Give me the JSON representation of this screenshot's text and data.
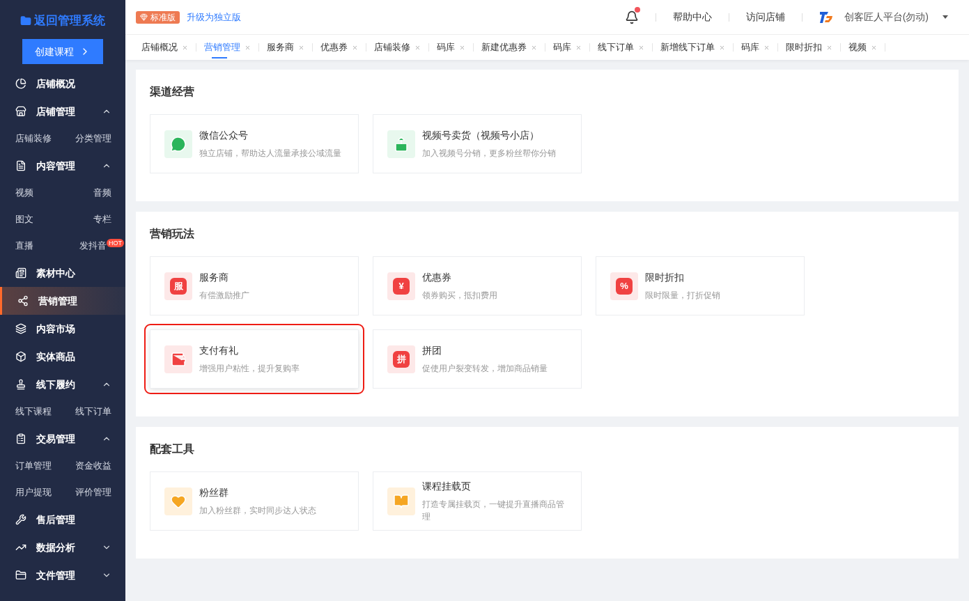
{
  "sidebar": {
    "title": "返回管理系统",
    "create_button": "创建课程",
    "items": [
      {
        "kind": "link",
        "label": "店铺概况",
        "selected": false
      },
      {
        "kind": "group",
        "label": "店铺管理",
        "selected": false,
        "expanded": true,
        "children": [
          {
            "label": "店铺装修"
          },
          {
            "label": "分类管理"
          }
        ]
      },
      {
        "kind": "group",
        "label": "内容管理",
        "selected": false,
        "expanded": true,
        "children": [
          {
            "label": "视频"
          },
          {
            "label": "音频"
          },
          {
            "label": "图文"
          },
          {
            "label": "专栏"
          },
          {
            "label": "直播"
          },
          {
            "label": "发抖音",
            "badge": "HOT"
          }
        ]
      },
      {
        "kind": "link",
        "label": "素材中心",
        "selected": false
      },
      {
        "kind": "link",
        "label": "营销管理",
        "selected": true
      },
      {
        "kind": "link",
        "label": "内容市场",
        "selected": false
      },
      {
        "kind": "link",
        "label": "实体商品",
        "selected": false
      },
      {
        "kind": "group",
        "label": "线下履约",
        "selected": false,
        "expanded": true,
        "children": [
          {
            "label": "线下课程"
          },
          {
            "label": "线下订单"
          }
        ]
      },
      {
        "kind": "group",
        "label": "交易管理",
        "selected": false,
        "expanded": true,
        "children": [
          {
            "label": "订单管理"
          },
          {
            "label": "资金收益"
          },
          {
            "label": "用户提现"
          },
          {
            "label": "评价管理"
          }
        ]
      },
      {
        "kind": "link",
        "label": "售后管理",
        "selected": false
      },
      {
        "kind": "group",
        "label": "数据分析",
        "selected": false,
        "expanded": false
      },
      {
        "kind": "group",
        "label": "文件管理",
        "selected": false,
        "expanded": false
      }
    ]
  },
  "header": {
    "edition_badge": "标准版",
    "upgrade_link": "升级为独立版",
    "notification_dot": true,
    "links": [
      "帮助中心",
      "访问店铺"
    ],
    "account": "创客匠人平台(勿动)"
  },
  "tabs": [
    {
      "label": "店铺概况",
      "selected": false
    },
    {
      "label": "营销管理",
      "selected": true
    },
    {
      "label": "服务商",
      "selected": false
    },
    {
      "label": "优惠券",
      "selected": false
    },
    {
      "label": "店铺装修",
      "selected": false
    },
    {
      "label": "码库",
      "selected": false
    },
    {
      "label": "新建优惠券",
      "selected": false
    },
    {
      "label": "码库",
      "selected": false
    },
    {
      "label": "线下订单",
      "selected": false
    },
    {
      "label": "新增线下订单",
      "selected": false
    },
    {
      "label": "码库",
      "selected": false
    },
    {
      "label": "限时折扣",
      "selected": false
    },
    {
      "label": "视频",
      "selected": false
    }
  ],
  "sections": [
    {
      "title": "渠道经营",
      "cards": [
        {
          "title": "微信公众号",
          "desc": "独立店铺，帮助达人流量承接公域流量",
          "highlighted": false
        },
        {
          "title": "视频号卖货（视频号小店）",
          "desc": "加入视频号分销，更多粉丝帮你分销",
          "highlighted": false
        }
      ]
    },
    {
      "title": "营销玩法",
      "cards": [
        {
          "title": "服务商",
          "desc": "有偿激励推广",
          "glyph": "服",
          "highlighted": false
        },
        {
          "title": "优惠券",
          "desc": "领券购买，抵扣费用",
          "glyph": "¥",
          "highlighted": false
        },
        {
          "title": "限时折扣",
          "desc": "限时限量，打折促销",
          "glyph": "%",
          "highlighted": false
        },
        {
          "title": "支付有礼",
          "desc": "增强用户粘性，提升复购率",
          "highlighted": true
        },
        {
          "title": "拼团",
          "desc": "促使用户裂变转发，增加商品销量",
          "glyph": "拼",
          "highlighted": false
        }
      ]
    },
    {
      "title": "配套工具",
      "cards": [
        {
          "title": "粉丝群",
          "desc": "加入粉丝群，实时同步达人状态",
          "highlighted": false
        },
        {
          "title": "课程挂载页",
          "desc": "打造专属挂载页，一键提升直播商品管理",
          "highlighted": false
        }
      ]
    }
  ]
}
